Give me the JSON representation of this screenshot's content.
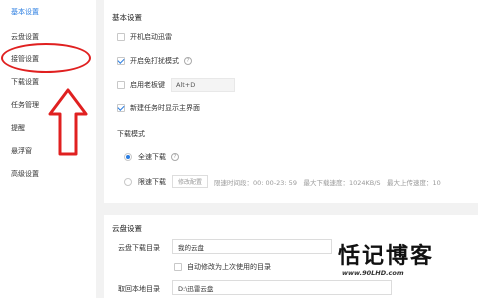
{
  "sidebar": {
    "items": [
      {
        "label": "基本设置",
        "active": true
      },
      {
        "label": "云盘设置",
        "active": false
      },
      {
        "label": "接管设置",
        "active": false
      },
      {
        "label": "下载设置",
        "active": false
      },
      {
        "label": "任务管理",
        "active": false
      },
      {
        "label": "提醒",
        "active": false
      },
      {
        "label": "悬浮窗",
        "active": false
      },
      {
        "label": "高级设置",
        "active": false
      }
    ]
  },
  "basic": {
    "title": "基本设置",
    "startup_label": "开机启动迅雷",
    "startup_checked": false,
    "no_disturb_label": "开启免打扰模式",
    "no_disturb_checked": true,
    "boss_key_label": "启用老板键",
    "boss_key_checked": false,
    "boss_key_value": "Alt+D",
    "show_main_label": "新建任务时显示主界面",
    "show_main_checked": true,
    "download_mode_label": "下载模式",
    "full_speed_label": "全速下载",
    "full_speed_selected": true,
    "limit_label": "限速下载",
    "limit_selected": false,
    "modify_config_label": "修改配置",
    "limit_info": "限速时间段：00: 00-23: 59　最大下载速度：1024KB/S　最大上传速度：10"
  },
  "cloud": {
    "title": "云盘设置",
    "download_dir_label": "云盘下载目录",
    "download_dir_value": "我的云盘",
    "auto_modify_label": "自动修改为上次使用的目录",
    "auto_modify_checked": false,
    "local_dir_label": "取回本地目录",
    "local_dir_value": "D:\\迅雷云盘"
  },
  "watermark": {
    "title": "恬记博客",
    "url": "www.90LHD.com"
  },
  "colors": {
    "accent": "#2a7de1",
    "annotation": "#e02020"
  }
}
